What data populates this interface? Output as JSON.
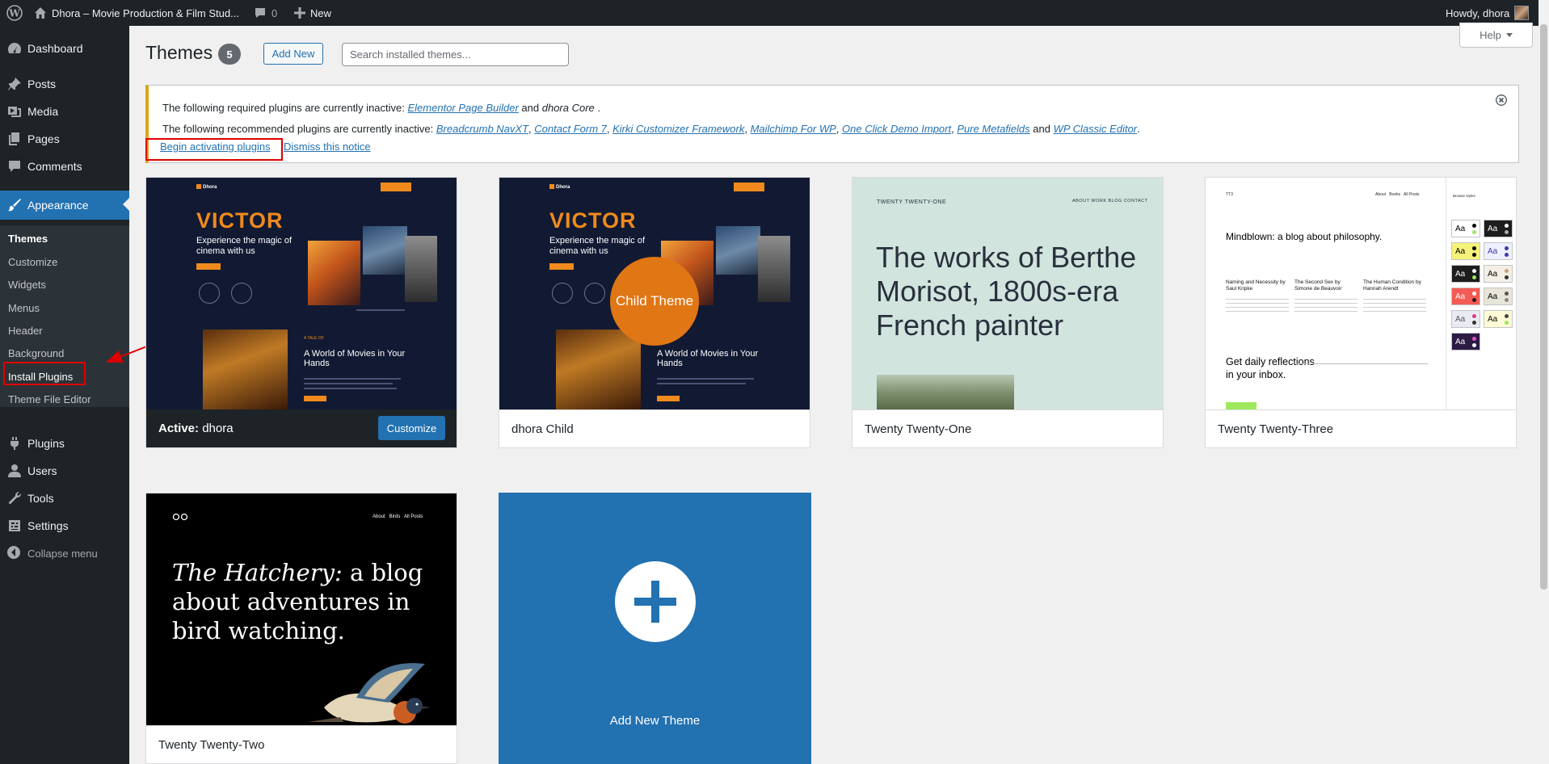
{
  "adminbar": {
    "site_title": "Dhora – Movie Production & Film Stud...",
    "comments_count": "0",
    "new_label": "New",
    "howdy": "Howdy, dhora"
  },
  "menu": {
    "items": [
      {
        "label": "Dashboard",
        "icon": "dashboard-icon"
      },
      {
        "label": "Posts",
        "icon": "pin-icon"
      },
      {
        "label": "Media",
        "icon": "media-icon"
      },
      {
        "label": "Pages",
        "icon": "pages-icon"
      },
      {
        "label": "Comments",
        "icon": "comment-icon"
      },
      {
        "label": "Appearance",
        "icon": "brush-icon"
      },
      {
        "label": "Plugins",
        "icon": "plugin-icon"
      },
      {
        "label": "Users",
        "icon": "user-icon"
      },
      {
        "label": "Tools",
        "icon": "wrench-icon"
      },
      {
        "label": "Settings",
        "icon": "settings-icon"
      }
    ],
    "collapse_label": "Collapse menu",
    "appearance_sub": [
      "Themes",
      "Customize",
      "Widgets",
      "Menus",
      "Header",
      "Background",
      "Install Plugins",
      "Theme File Editor"
    ]
  },
  "page": {
    "title": "Themes",
    "count": "5",
    "add_new": "Add New",
    "search_placeholder": "Search installed themes...",
    "help": "Help"
  },
  "notice": {
    "required_prefix": "The following required plugins are currently inactive: ",
    "required_plugin_1": "Elementor Page Builder",
    "required_and": " and ",
    "required_plugin_2": "dhora Core",
    "required_end": " .",
    "recommended_prefix": "The following recommended plugins are currently inactive: ",
    "recommended": [
      "Breadcrumb NavXT",
      "Contact Form 7",
      "Kirki Customizer Framework",
      "Mailchimp For WP",
      "One Click Demo Import",
      "Pure Metafields"
    ],
    "recommended_and": " and ",
    "recommended_last": "WP Classic Editor",
    "sep": ", ",
    "end": ".",
    "begin_activating": "Begin activating plugins",
    "dismiss": "Dismiss this notice"
  },
  "themes": {
    "active_prefix": "Active:",
    "active_name": "dhora",
    "customize": "Customize",
    "child_name": "dhora Child",
    "child_badge": "Child Theme",
    "t21_name": "Twenty Twenty-One",
    "t23_name": "Twenty Twenty-Three",
    "t22_name": "Twenty Twenty-Two",
    "add_new_theme": "Add New Theme"
  },
  "previews": {
    "victor": {
      "logo": "Dhora",
      "title": "VICTOR",
      "subtitle": "Experience the magic of cinema with us",
      "kicker": "A TALE OF",
      "h2": "A World of Movies in Your Hands"
    },
    "t21": {
      "site": "TWENTY TWENTY-ONE",
      "nav": "ABOUT   WORK   BLOG   CONTACT",
      "headline": "The works of Berthe Morisot, 1800s-era French painter"
    },
    "t23": {
      "site": "TT3",
      "nav": "About   Books   All Posts",
      "headline": "Mindblown: a blog about philosophy.",
      "col1": "Naming and Necessity by Saul Kripke",
      "col2": "The Second Sex by Simone de Beauvoir",
      "col3": "The Human Condition by Hannah Arendt",
      "cta": "Get daily reflections in your inbox.",
      "styles_title": "Browse styles",
      "swatch_text": "Aa"
    },
    "t22": {
      "nav": "About   Birds   All Posts",
      "headline_em": "The Hatchery:",
      "headline_rest": " a blog about adventures in bird watching."
    }
  },
  "colors": {
    "admin_dark": "#1d2327",
    "accent": "#2271b1",
    "notice_warning": "#dba617",
    "annotation_red": "#e00000",
    "child_badge": "#e07614"
  }
}
